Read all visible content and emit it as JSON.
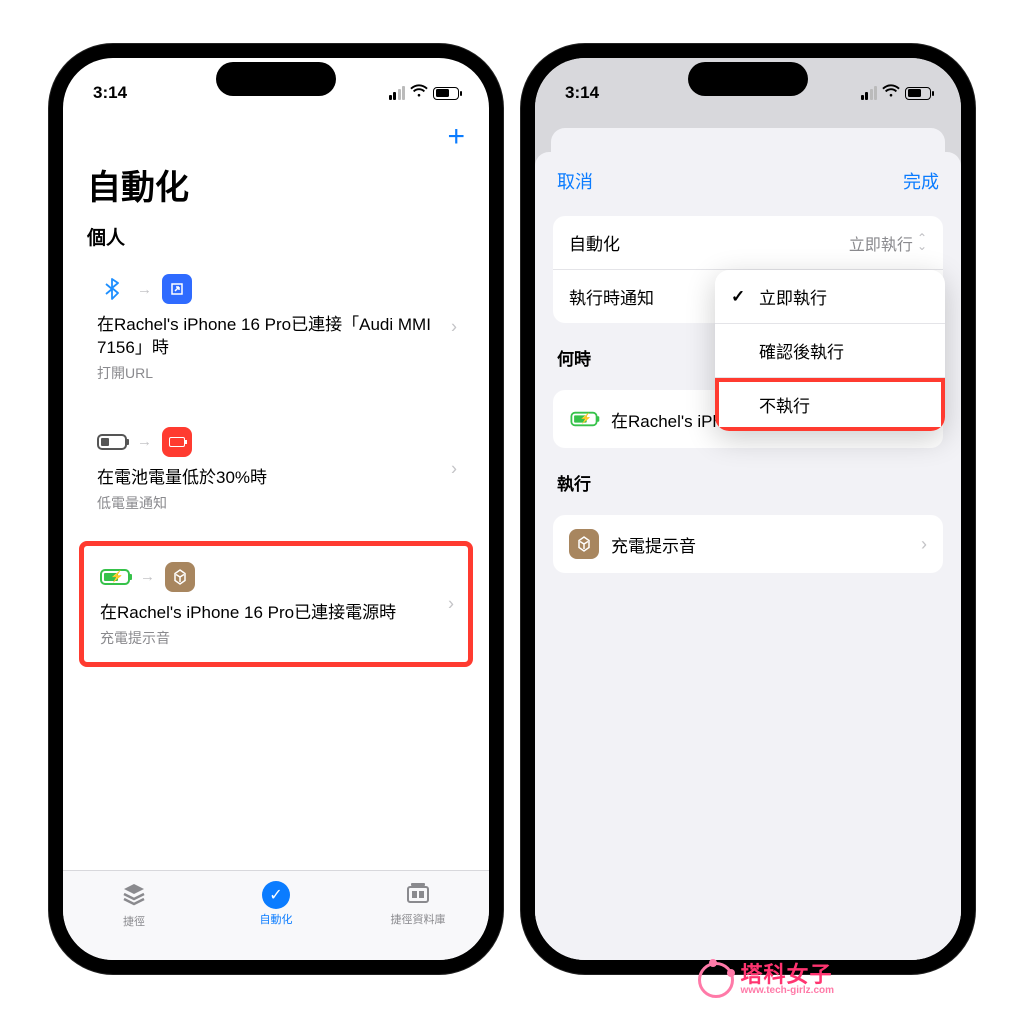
{
  "status": {
    "time": "3:14"
  },
  "left": {
    "add_icon": "+",
    "title": "自動化",
    "section": "個人",
    "cards": [
      {
        "title": "在Rachel's iPhone 16 Pro已連接「Audi MMI 7156」時",
        "sub": "打開URL"
      },
      {
        "title": "在電池電量低於30%時",
        "sub": "低電量通知"
      },
      {
        "title": "在Rachel's iPhone 16 Pro已連接電源時",
        "sub": "充電提示音"
      }
    ],
    "tabs": {
      "shortcuts": "捷徑",
      "automation": "自動化",
      "gallery": "捷徑資料庫"
    }
  },
  "right": {
    "cancel": "取消",
    "done": "完成",
    "rows": {
      "automation_label": "自動化",
      "automation_value": "立即執行",
      "notify_label": "執行時通知"
    },
    "menu": {
      "opt1": "立即執行",
      "opt2": "確認後執行",
      "opt3": "不執行"
    },
    "when": {
      "header": "何時",
      "row": "在Rachel's iPhone 16 Pro已連接電源時"
    },
    "do": {
      "header": "執行",
      "row": "充電提示音"
    }
  },
  "watermark": {
    "cn": "塔科女子",
    "url": "www.tech-girlz.com"
  }
}
